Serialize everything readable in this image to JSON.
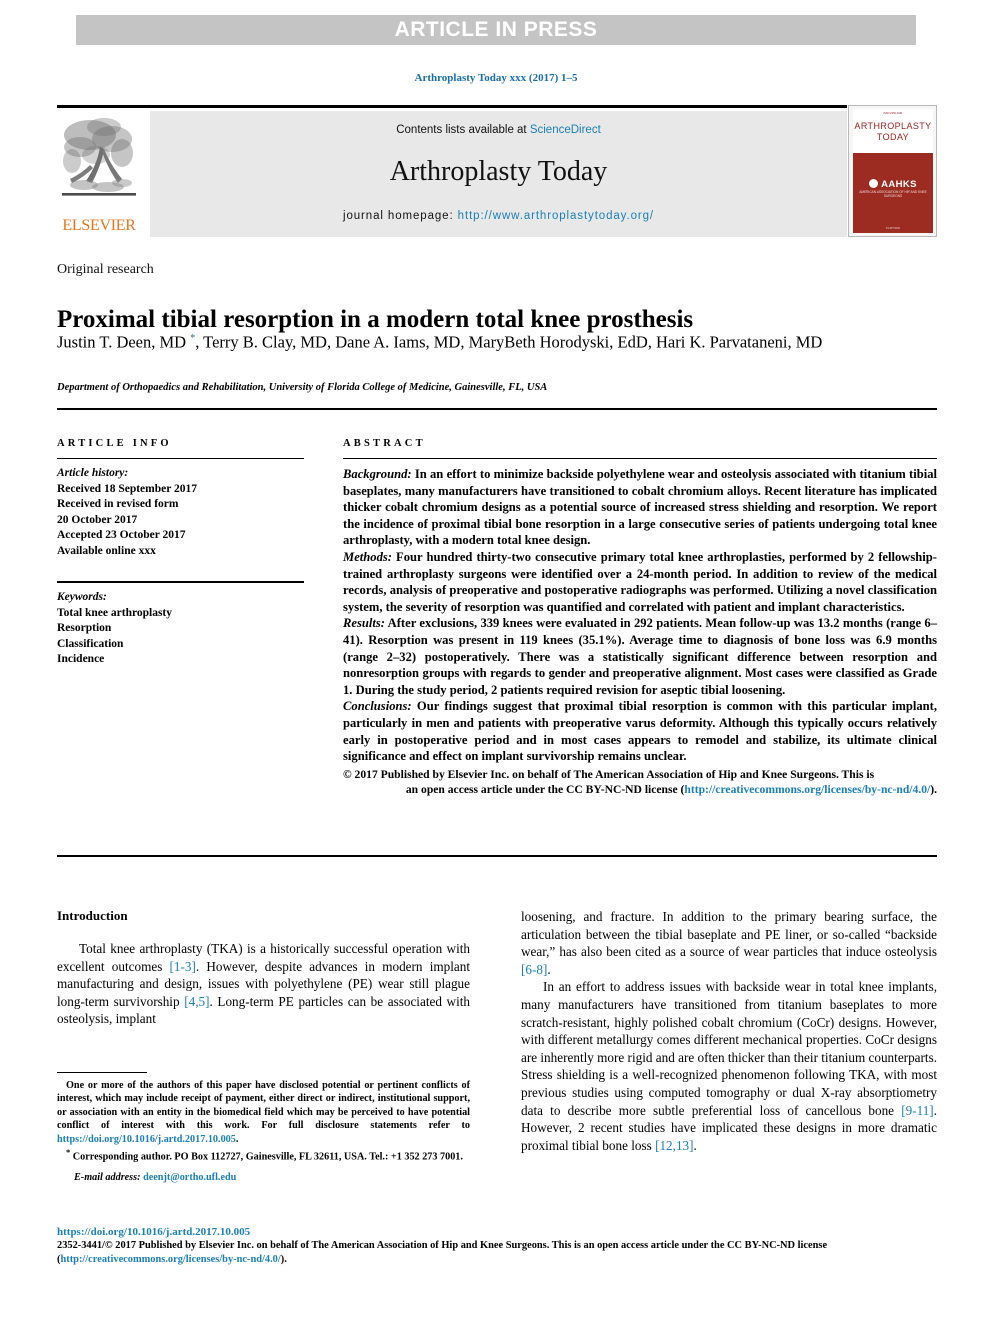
{
  "banner": {
    "text": "ARTICLE IN PRESS"
  },
  "running_head": {
    "text": "Arthroplasty Today xxx (2017) 1–5"
  },
  "masthead": {
    "contents_prefix": "Contents lists available at ",
    "contents_link": "ScienceDirect",
    "journal_title": "Arthroplasty Today",
    "homepage_prefix": "journal homepage: ",
    "homepage_link": "http://www.arthroplastytoday.org/",
    "publisher_name": "ELSEVIER",
    "cover": {
      "tiny_top": "ISSN 2352-3441",
      "title_line1": "ARTHROPLASTY",
      "title_line2": "TODAY",
      "society_abbr": "AAHKS",
      "society_full": "AMERICAN ASSOCIATION OF HIP AND KNEE SURGEONS",
      "publisher_mark": "ELSEVIER"
    }
  },
  "article": {
    "type": "Original research",
    "title": "Proximal tibial resorption in a modern total knee prosthesis",
    "authors": "Justin T. Deen, MD ",
    "authors_marker": "*",
    "authors_rest": ", Terry B. Clay, MD, Dane A. Iams, MD, MaryBeth Horodyski, EdD, Hari K. Parvataneni, MD",
    "affiliation": "Department of Orthopaedics and Rehabilitation, University of Florida College of Medicine, Gainesville, FL, USA"
  },
  "article_info": {
    "heading": "ARTICLE INFO",
    "history_label": "Article history:",
    "history_lines": [
      "Received 18 September 2017",
      "Received in revised form",
      "20 October 2017",
      "Accepted 23 October 2017",
      "Available online xxx"
    ],
    "keywords_label": "Keywords:",
    "keywords": [
      "Total knee arthroplasty",
      "Resorption",
      "Classification",
      "Incidence"
    ]
  },
  "abstract": {
    "heading": "ABSTRACT",
    "background_label": "Background:",
    "background_text": " In an effort to minimize backside polyethylene wear and osteolysis associated with titanium tibial baseplates, many manufacturers have transitioned to cobalt chromium alloys. Recent literature has implicated thicker cobalt chromium designs as a potential source of increased stress shielding and resorption. We report the incidence of proximal tibial bone resorption in a large consecutive series of patients undergoing total knee arthroplasty, with a modern total knee design.",
    "methods_label": "Methods:",
    "methods_text": " Four hundred thirty-two consecutive primary total knee arthroplasties, performed by 2 fellowship-trained arthroplasty surgeons were identified over a 24-month period. In addition to review of the medical records, analysis of preoperative and postoperative radiographs was performed. Utilizing a novel classification system, the severity of resorption was quantified and correlated with patient and implant characteristics.",
    "results_label": "Results:",
    "results_text": " After exclusions, 339 knees were evaluated in 292 patients. Mean follow-up was 13.2 months (range 6–41). Resorption was present in 119 knees (35.1%). Average time to diagnosis of bone loss was 6.9 months (range 2–32) postoperatively. There was a statistically significant difference between resorption and nonresorption groups with regards to gender and preoperative alignment. Most cases were classified as Grade 1. During the study period, 2 patients required revision for aseptic tibial loosening.",
    "conclusions_label": "Conclusions:",
    "conclusions_text": " Our findings suggest that proximal tibial resorption is common with this particular implant, particularly in men and patients with preoperative varus deformity. Although this typically occurs relatively early in postoperative period and in most cases appears to remodel and stabilize, its ultimate clinical significance and effect on implant survivorship remains unclear.",
    "copyright_line": "© 2017 Published by Elsevier Inc. on behalf of The American Association of Hip and Knee Surgeons. This is",
    "license_text": "an open access article under the CC BY-NC-ND license (",
    "license_link": "http://creativecommons.org/licenses/by-nc-nd/4.0/",
    "license_suffix": ")."
  },
  "body": {
    "intro_heading": "Introduction",
    "left_paragraphs": [
      "Total knee arthroplasty (TKA) is a historically successful operation with excellent outcomes [1-3]. However, despite advances in modern implant manufacturing and design, issues with polyethylene (PE) wear still plague long-term survivorship [4,5]. Long-term PE particles can be associated with osteolysis, implant"
    ],
    "right_paragraphs": [
      "loosening, and fracture. In addition to the primary bearing surface, the articulation between the tibial baseplate and PE liner, or so-called “backside wear,” has also been cited as a source of wear particles that induce osteolysis [6-8].",
      "In an effort to address issues with backside wear in total knee implants, many manufacturers have transitioned from titanium baseplates to more scratch-resistant, highly polished cobalt chromium (CoCr) designs. However, with different metallurgy comes different mechanical properties. CoCr designs are inherently more rigid and are often thicker than their titanium counterparts. Stress shielding is a well-recognized phenomenon following TKA, with most previous studies using computed tomography or dual X-ray absorptiometry data to describe more subtle preferential loss of cancellous bone [9-11]. However, 2 recent studies have implicated these designs in more dramatic proximal tibial bone loss [12,13]."
    ]
  },
  "footnote": {
    "disclosure_text": "One or more of the authors of this paper have disclosed potential or pertinent conflicts of interest, which may include receipt of payment, either direct or indirect, institutional support, or association with an entity in the biomedical field which may be perceived to have potential conflict of interest with this work. For full disclosure statements refer to ",
    "disclosure_link": "https://doi.org/10.1016/j.artd.2017.10.005",
    "disclosure_suffix": ".",
    "corresponding_marker": "*",
    "corresponding_text": " Corresponding author. PO Box 112727, Gainesville, FL 32611, USA. Tel.: +1 352 273 7001.",
    "email_label": "E-mail address:",
    "email_value": "deenjt@ortho.ufl.edu"
  },
  "footer": {
    "doi": "https://doi.org/10.1016/j.artd.2017.10.005",
    "issn_copyright": "2352-3441/© 2017 Published by Elsevier Inc. on behalf of The American Association of Hip and Knee Surgeons. This is an open access article under the CC BY-NC-ND license",
    "license_open": "(",
    "license_link": "http://creativecommons.org/licenses/by-nc-nd/4.0/",
    "license_close": ")."
  },
  "colors": {
    "link_blue": "#1a7fb5",
    "banner_gray": "#c4c4c4",
    "masthead_gray": "#e8e8e8",
    "elsevier_orange": "#e8751a",
    "cover_red": "#9c2b22"
  }
}
